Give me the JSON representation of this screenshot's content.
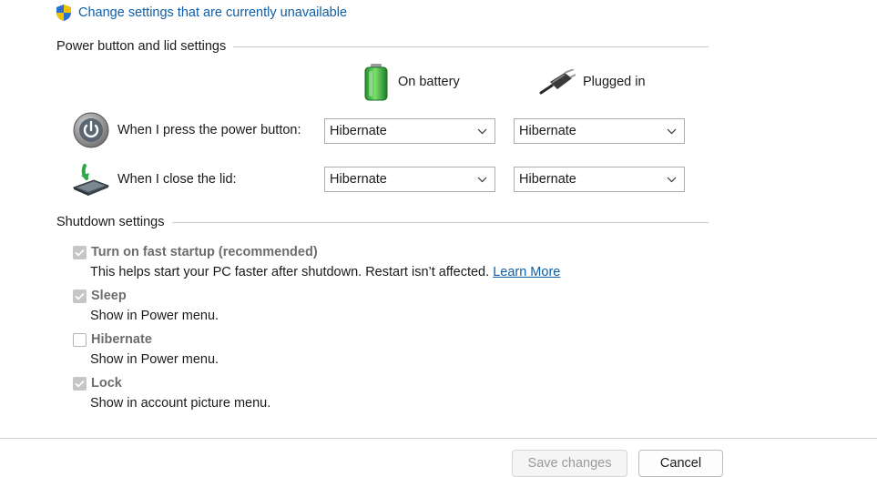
{
  "top_link": {
    "label": "Change settings that are currently unavailable",
    "icon": "uac-shield-icon"
  },
  "power_section": {
    "title": "Power button and lid settings",
    "columns": {
      "battery": {
        "label": "On battery",
        "icon": "battery-icon"
      },
      "plugged": {
        "label": "Plugged in",
        "icon": "plug-icon"
      }
    },
    "rows": [
      {
        "label": "When I press the power button:",
        "icon": "power-button-icon",
        "battery_value": "Hibernate",
        "plugged_value": "Hibernate"
      },
      {
        "label": "When I close the lid:",
        "icon": "laptop-lid-icon",
        "battery_value": "Hibernate",
        "plugged_value": "Hibernate"
      }
    ]
  },
  "shutdown_section": {
    "title": "Shutdown settings",
    "options": [
      {
        "label": "Turn on fast startup (recommended)",
        "checked": true,
        "description": "This helps start your PC faster after shutdown. Restart isn’t affected.",
        "link": "Learn More"
      },
      {
        "label": "Sleep",
        "checked": true,
        "description": "Show in Power menu."
      },
      {
        "label": "Hibernate",
        "checked": false,
        "description": "Show in Power menu."
      },
      {
        "label": "Lock",
        "checked": true,
        "description": "Show in account picture menu."
      }
    ]
  },
  "footer": {
    "save_label": "Save changes",
    "cancel_label": "Cancel"
  },
  "colors": {
    "link": "#0e5ea8",
    "disabled_text": "#6d6d6d",
    "battery_green": "#3cb043"
  }
}
